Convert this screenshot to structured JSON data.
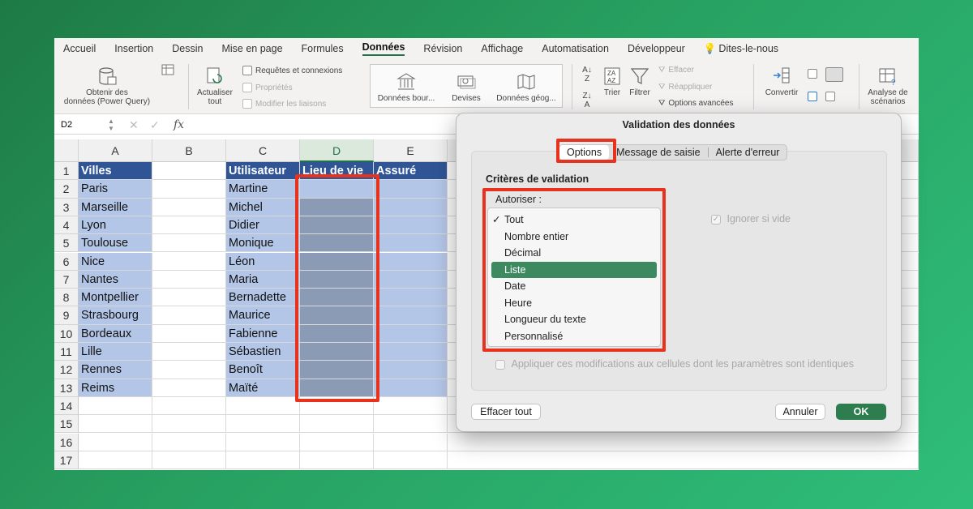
{
  "ribbon_tabs": [
    "Accueil",
    "Insertion",
    "Dessin",
    "Mise en page",
    "Formules",
    "Données",
    "Révision",
    "Affichage",
    "Automatisation",
    "Développeur",
    "Dites-le-nous"
  ],
  "active_tab": "Données",
  "ribbon": {
    "get_data_line1": "Obtenir des",
    "get_data_line2": "données (Power Query)",
    "refresh_line1": "Actualiser",
    "refresh_line2": "tout",
    "queries": "Requêtes et connexions",
    "properties": "Propriétés",
    "edit_links": "Modifier les liaisons",
    "datatype_stocks": "Données bour...",
    "datatype_currencies": "Devises",
    "datatype_geo": "Données géog...",
    "sort": "Trier",
    "filter": "Filtrer",
    "clear": "Effacer",
    "reapply": "Réappliquer",
    "advanced": "Options avancées",
    "convert": "Convertir",
    "whatif_line1": "Analyse de",
    "whatif_line2": "scénarios"
  },
  "formula_bar": {
    "name_box": "D2",
    "fx": "fx"
  },
  "columns": [
    "A",
    "B",
    "C",
    "D",
    "E"
  ],
  "rows": [
    "1",
    "2",
    "3",
    "4",
    "5",
    "6",
    "7",
    "8",
    "9",
    "10",
    "11",
    "12",
    "13",
    "14",
    "15",
    "16",
    "17"
  ],
  "headers": {
    "A": "Villes",
    "C": "Utilisateur",
    "D": "Lieu de vie",
    "E": "Assuré"
  },
  "cities": [
    "Paris",
    "Marseille",
    "Lyon",
    "Toulouse",
    "Nice",
    "Nantes",
    "Montpellier",
    "Strasbourg",
    "Bordeaux",
    "Lille",
    "Rennes",
    "Reims"
  ],
  "users": [
    "Martine",
    "Michel",
    "Didier",
    "Monique",
    "Léon",
    "Maria",
    "Bernadette",
    "Maurice",
    "Fabienne",
    "Sébastien",
    "Benoît",
    "Maïté"
  ],
  "dialog": {
    "title": "Validation des données",
    "tabs": [
      "Options",
      "Message de saisie",
      "Alerte d'erreur"
    ],
    "section": "Critères de validation",
    "allow_label": "Autoriser :",
    "allow_options": [
      "Tout",
      "Nombre entier",
      "Décimal",
      "Liste",
      "Date",
      "Heure",
      "Longueur du texte",
      "Personnalisé"
    ],
    "checked_option": "Tout",
    "highlighted_option": "Liste",
    "ignore_blank": "Ignorer si vide",
    "apply_all": "Appliquer ces modifications aux cellules dont les paramètres sont identiques",
    "clear_all": "Effacer tout",
    "cancel": "Annuler",
    "ok": "OK"
  },
  "colors": {
    "accent": "#217346",
    "header_fill": "#2f5597",
    "cell_fill": "#b4c6e7",
    "highlight_red": "#e8321e",
    "menu_highlight": "#3d8a61"
  }
}
